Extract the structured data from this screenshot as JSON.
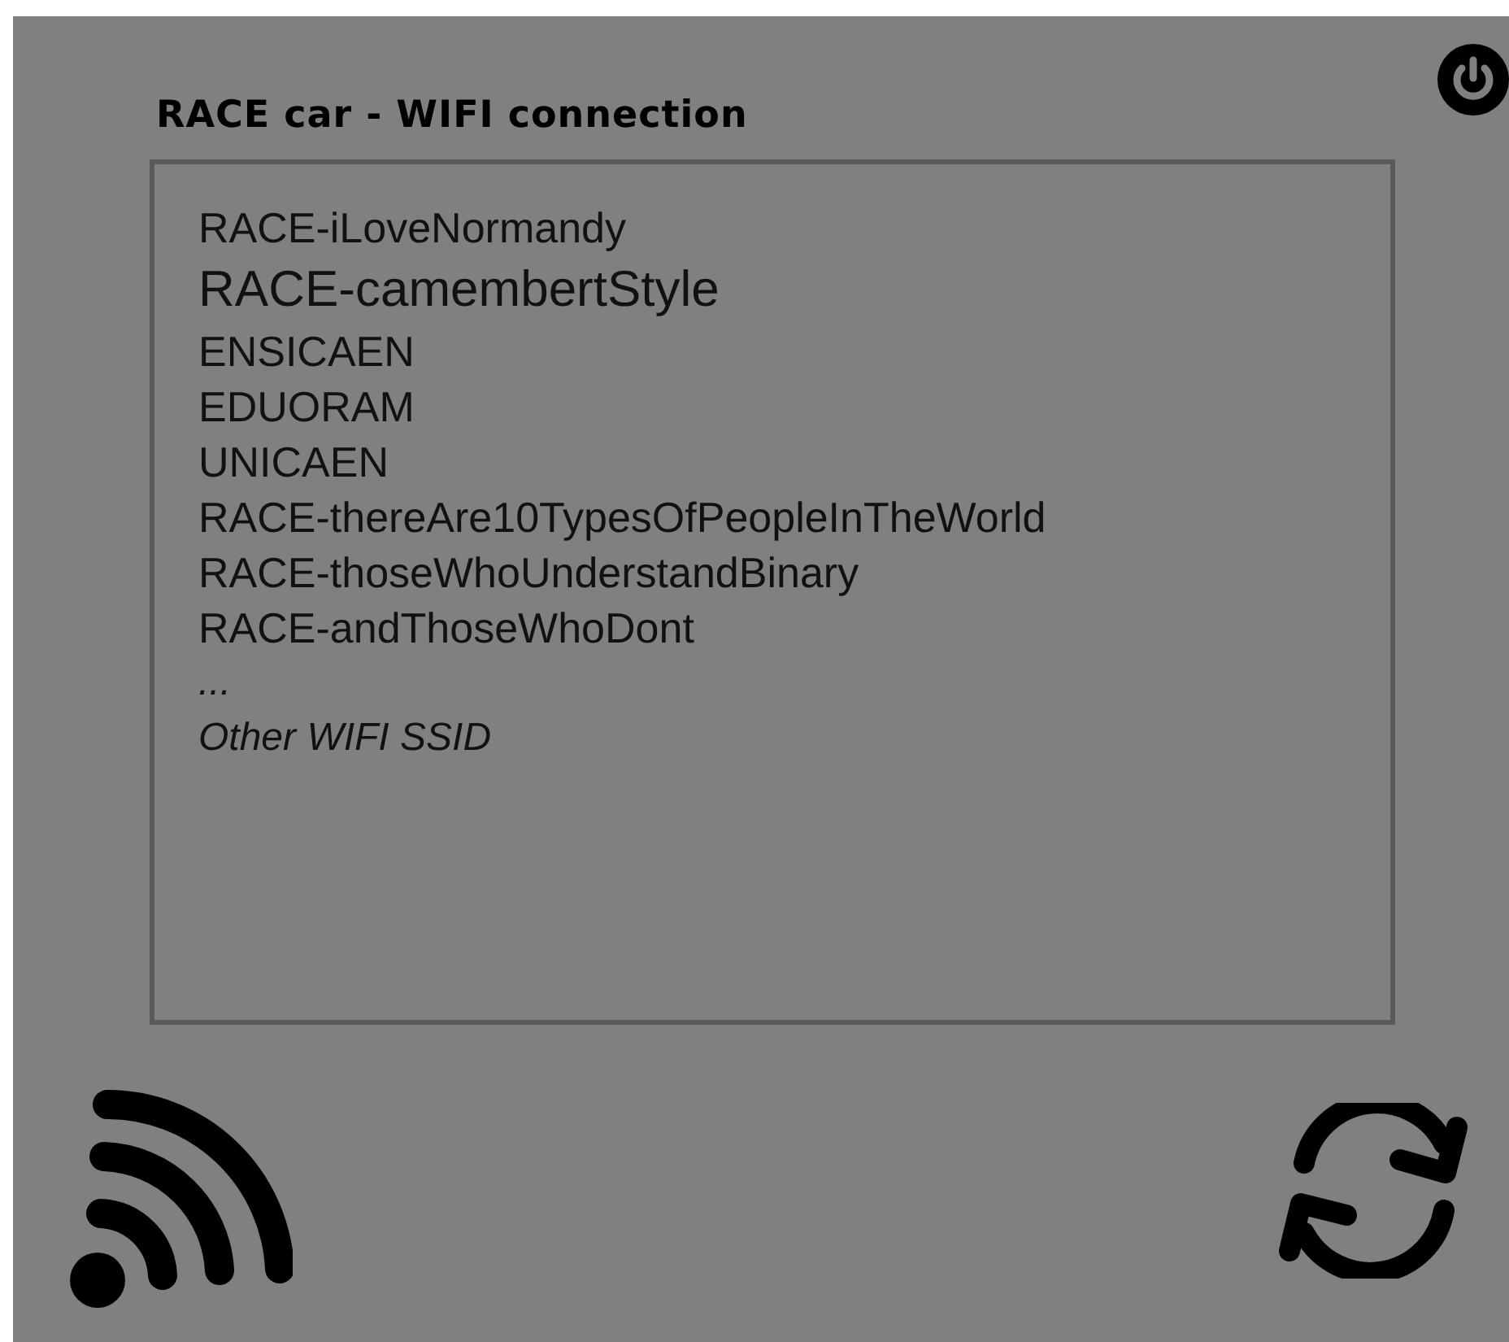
{
  "title": "RACE car - WIFI connection",
  "networks": [
    {
      "ssid": "RACE-iLoveNormandy",
      "selected": false
    },
    {
      "ssid": "RACE-camembertStyle",
      "selected": true
    },
    {
      "ssid": "ENSICAEN",
      "selected": false
    },
    {
      "ssid": "EDUORAM",
      "selected": false
    },
    {
      "ssid": "UNICAEN",
      "selected": false
    },
    {
      "ssid": "RACE-thereAre10TypesOfPeopleInTheWorld",
      "selected": false
    },
    {
      "ssid": "RACE-thoseWhoUnderstandBinary",
      "selected": false
    },
    {
      "ssid": "RACE-andThoseWhoDont",
      "selected": false
    }
  ],
  "more_indicator": "...",
  "other_option": "Other WIFI SSID"
}
